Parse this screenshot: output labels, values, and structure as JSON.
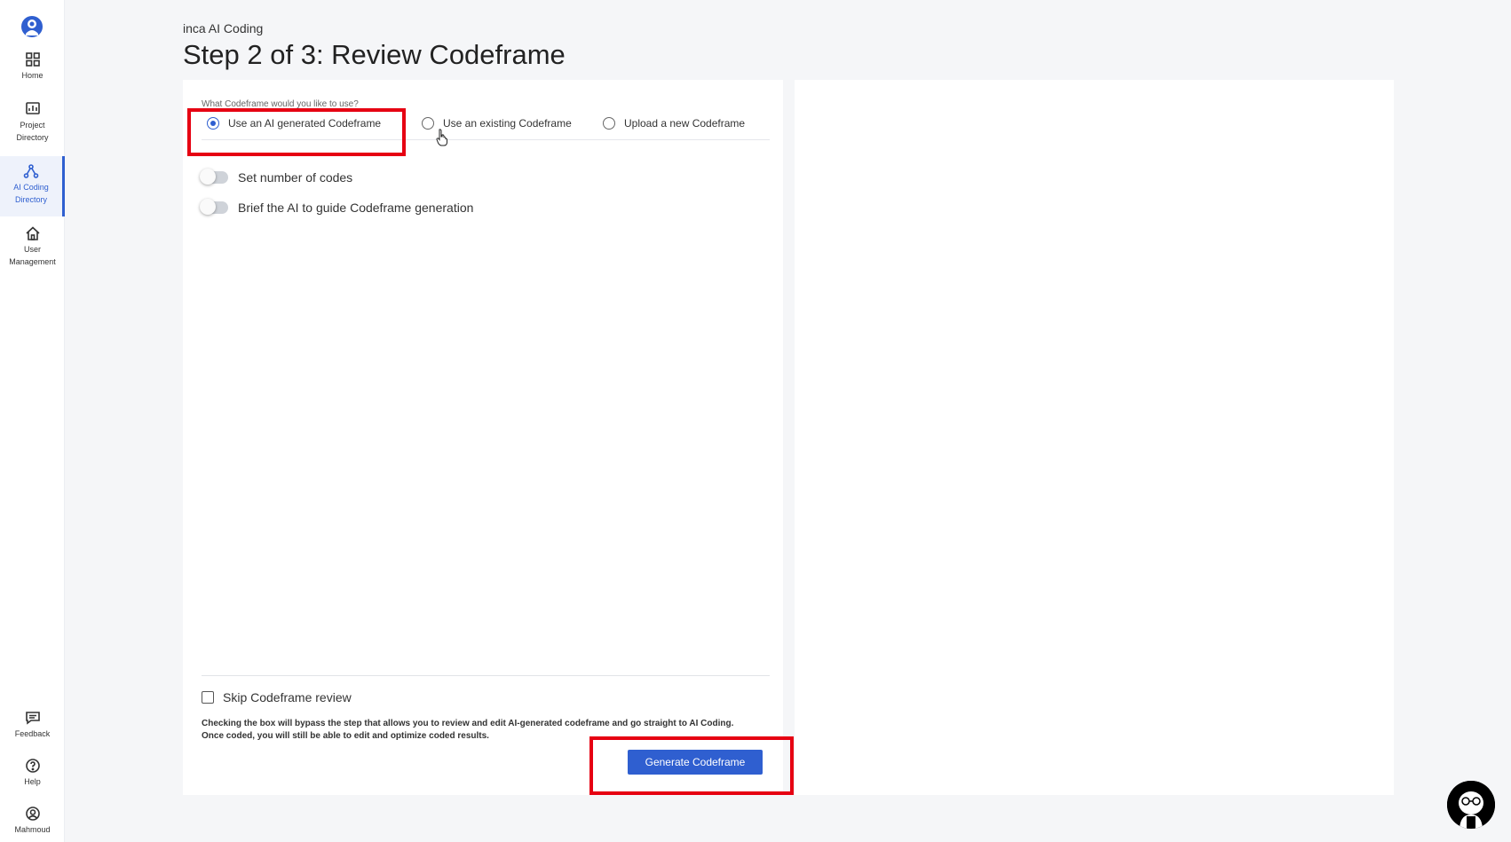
{
  "sidebar": {
    "logo_icon": "user-circle-logo-icon",
    "items": [
      {
        "label": "Home",
        "icon": "grid-icon"
      },
      {
        "label": "Project Directory",
        "icon": "chart-board-icon"
      },
      {
        "label": "AI Coding Directory",
        "icon": "network-icon",
        "active": true
      },
      {
        "label": "User Management",
        "icon": "house-icon"
      }
    ],
    "bottom_items": [
      {
        "label": "Feedback",
        "icon": "feedback-icon"
      },
      {
        "label": "Help",
        "icon": "help-icon"
      },
      {
        "label": "Mahmoud",
        "icon": "user-account-icon"
      }
    ]
  },
  "header": {
    "breadcrumb": "inca AI Coding",
    "title": "Step 2 of 3: Review Codeframe"
  },
  "form": {
    "question": "What Codeframe would you like to use?",
    "options": [
      {
        "label": "Use an AI generated Codeframe",
        "checked": true
      },
      {
        "label": "Use an existing Codeframe",
        "checked": false
      },
      {
        "label": "Upload a new Codeframe",
        "checked": false
      }
    ],
    "toggles": [
      {
        "label": "Set number of codes",
        "on": false
      },
      {
        "label": "Brief the AI to guide Codeframe generation",
        "on": false
      }
    ],
    "skip_label": "Skip Codeframe review",
    "skip_checked": false,
    "help_text": "Checking the box will bypass the step that allows you to review and edit AI-generated codeframe and go straight to AI Coding. Once coded, you will still be able to edit and optimize coded results.",
    "generate_button": "Generate Codeframe"
  },
  "colors": {
    "accent": "#2f5fd0",
    "highlight": "#e60012"
  }
}
